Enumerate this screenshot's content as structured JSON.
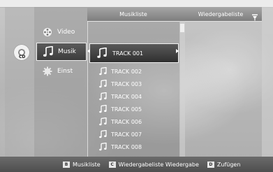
{
  "source": {
    "label": "CD",
    "icon": "cd-icon"
  },
  "menu": [
    {
      "label": "Video",
      "icon": "film-reel-icon"
    },
    {
      "label": "Musik",
      "icon": "music-note-icon"
    },
    {
      "label": "Einst",
      "icon": "gear-icon"
    }
  ],
  "list": {
    "header": "Musikliste",
    "selected": "TRACK 001",
    "tracks": [
      "TRACK 002",
      "TRACK 003",
      "TRACK 004",
      "TRACK 005",
      "TRACK 006",
      "TRACK 007",
      "TRACK 008"
    ]
  },
  "playlist": {
    "header": "Wiedergabeliste",
    "pin_icon": "pin-icon"
  },
  "footer": [
    {
      "key": "B",
      "label": "Musikliste"
    },
    {
      "key": "C",
      "label": "Wiedergabeliste Wiedergabe"
    },
    {
      "key": "D",
      "label": "Zufügen"
    }
  ],
  "colors": {
    "text": "#ffffff",
    "highlight": "#3f3f3f",
    "border": "#f0f0f0"
  }
}
